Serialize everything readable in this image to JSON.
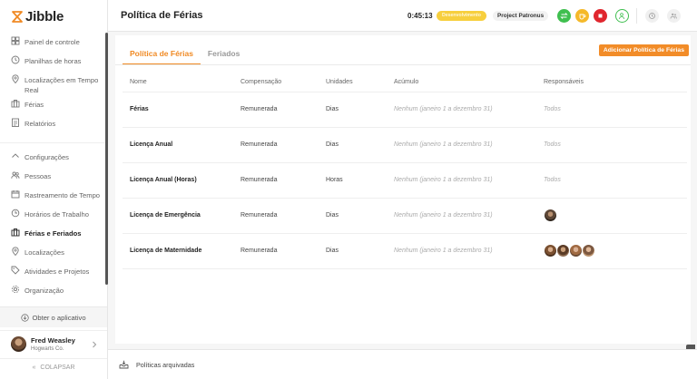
{
  "brand": {
    "name": "Jibble",
    "color": "#f08a24"
  },
  "sidebar": {
    "items": [
      {
        "label": "Painel de controle",
        "icon": "dashboard-icon"
      },
      {
        "label": "Planilhas de horas",
        "icon": "clock-icon"
      },
      {
        "label": "Localizações em Tempo Real",
        "icon": "location-pin-icon"
      },
      {
        "label": "Férias",
        "icon": "suitcase-icon"
      },
      {
        "label": "Relatórios",
        "icon": "report-icon"
      }
    ],
    "config_label": "Configurações",
    "config_items": [
      {
        "label": "Pessoas",
        "icon": "people-icon"
      },
      {
        "label": "Rastreamento de Tempo",
        "icon": "time-tracking-icon"
      },
      {
        "label": "Horários de Trabalho",
        "icon": "work-schedule-icon"
      },
      {
        "label": "Férias e Feriados",
        "icon": "suitcase-icon",
        "active": true
      },
      {
        "label": "Localizações",
        "icon": "location-pin-icon"
      },
      {
        "label": "Atividades e Projetos",
        "icon": "tag-icon"
      },
      {
        "label": "Organização",
        "icon": "gear-icon"
      }
    ],
    "get_app": "Obter o aplicativo",
    "user": {
      "name": "Fred Weasley",
      "org": "Hogwarts Co."
    },
    "collapse": "COLAPSAR"
  },
  "header": {
    "title": "Política de Férias",
    "timer": "0:45:13",
    "status_badge": "Desenvolvimento",
    "project": "Project Patronus",
    "colors": {
      "green": "#3fbf4f",
      "yellow": "#f5b92a",
      "red": "#e0262e"
    }
  },
  "tabs": [
    {
      "label": "Política de Férias",
      "active": true
    },
    {
      "label": "Feriados",
      "active": false
    }
  ],
  "add_button": "Adicionar Política de Férias",
  "table": {
    "columns": [
      "Nome",
      "Compensação",
      "Unidades",
      "Acúmulo",
      "Responsáveis"
    ],
    "rows": [
      {
        "name": "Férias",
        "comp": "Remunerada",
        "unit": "Dias",
        "accrual": "Nenhum (janeiro 1 a dezembro 31)",
        "resp": "Todos"
      },
      {
        "name": "Licença Anual",
        "comp": "Remunerada",
        "unit": "Dias",
        "accrual": "Nenhum (janeiro 1 a dezembro 31)",
        "resp": "Todos"
      },
      {
        "name": "Licença Anual (Horas)",
        "comp": "Remunerada",
        "unit": "Horas",
        "accrual": "Nenhum (janeiro 1 a dezembro 31)",
        "resp": "Todos"
      },
      {
        "name": "Licença de Emergência",
        "comp": "Remunerada",
        "unit": "Dias",
        "accrual": "Nenhum (janeiro 1 a dezembro 31)",
        "resp": ""
      },
      {
        "name": "Licença de Maternidade",
        "comp": "Remunerada",
        "unit": "Dias",
        "accrual": "Nenhum (janeiro 1 a dezembro 31)",
        "resp": ""
      }
    ]
  },
  "footer": {
    "archived": "Políticas arquivadas"
  }
}
